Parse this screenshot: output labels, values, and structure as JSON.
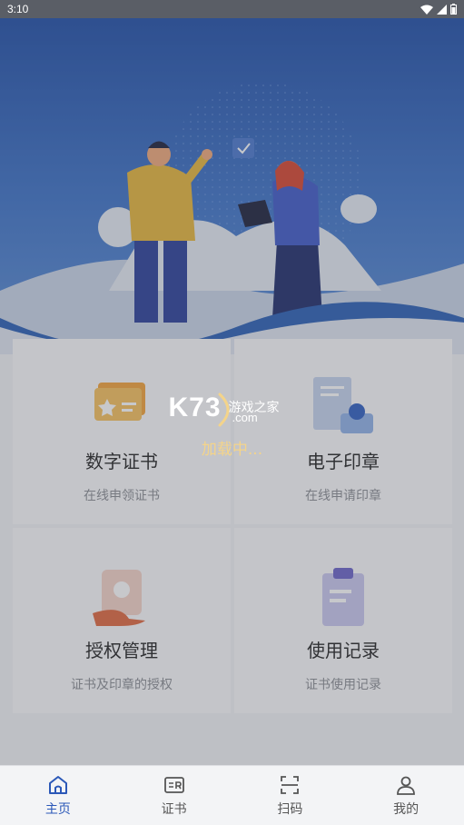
{
  "status_bar": {
    "time": "3:10"
  },
  "cards": [
    {
      "title": "数字证书",
      "subtitle": "在线申领证书"
    },
    {
      "title": "电子印章",
      "subtitle": "在线申请印章"
    },
    {
      "title": "授权管理",
      "subtitle": "证书及印章的授权"
    },
    {
      "title": "使用记录",
      "subtitle": "证书使用记录"
    }
  ],
  "loading": {
    "logo_text": "K73",
    "logo_cn": "游戏之家",
    "logo_com": ".com",
    "text": "加载中..."
  },
  "tabbar": {
    "items": [
      {
        "label": "主页",
        "icon": "home-icon",
        "active": true
      },
      {
        "label": "证书",
        "icon": "certificate-icon",
        "active": false
      },
      {
        "label": "扫码",
        "icon": "scan-icon",
        "active": false
      },
      {
        "label": "我的",
        "icon": "user-icon",
        "active": false
      }
    ]
  },
  "colors": {
    "accent": "#2b58b8",
    "hero": "#1f4ea8",
    "loading_text": "#f4d48a"
  }
}
